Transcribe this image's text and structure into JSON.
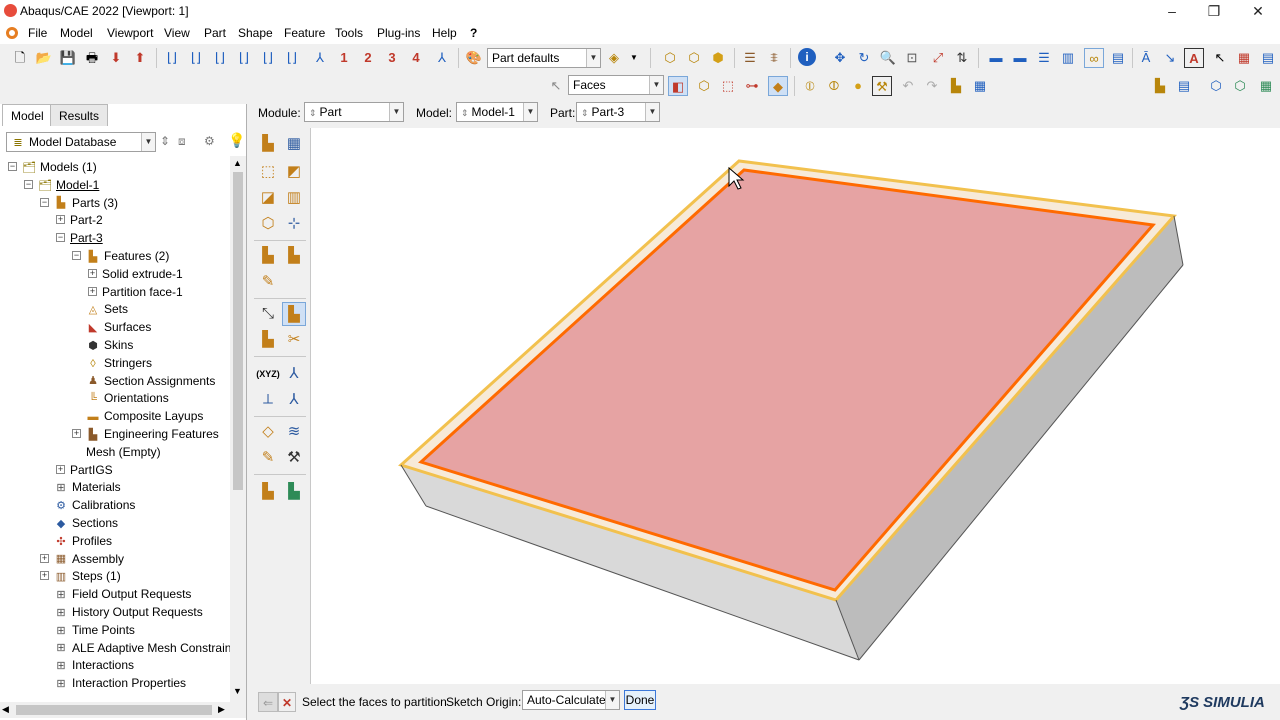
{
  "window": {
    "title": "Abaqus/CAE 2022 [Viewport: 1]",
    "controls": [
      "–",
      "❐",
      "✕"
    ],
    "resize_controls": [
      "–",
      "❐",
      "✕"
    ]
  },
  "menu": [
    {
      "label": "File"
    },
    {
      "label": "Model"
    },
    {
      "label": "Viewport"
    },
    {
      "label": "View"
    },
    {
      "label": "Part"
    },
    {
      "label": "Shape"
    },
    {
      "label": "Feature"
    },
    {
      "label": "Tools"
    },
    {
      "label": "Plug-ins"
    },
    {
      "label": "Help"
    },
    {
      "label": "?"
    }
  ],
  "toolbar": {
    "view_numbers": [
      "1",
      "2",
      "3",
      "4"
    ],
    "part_defaults": "Part defaults",
    "selection_filter": "Faces"
  },
  "context": {
    "module_label": "Module:",
    "module_value": "Part",
    "model_label": "Model:",
    "model_value": "Model-1",
    "part_label": "Part:",
    "part_value": "Part-3"
  },
  "left_panel": {
    "tabs": [
      "Model",
      "Results"
    ],
    "database_combo": "Model Database",
    "tree": [
      {
        "label": "Models (1)",
        "level": 0,
        "exp": "-"
      },
      {
        "label": "Model-1",
        "level": 1,
        "exp": "-",
        "underline": true
      },
      {
        "label": "Parts (3)",
        "level": 2,
        "exp": "-"
      },
      {
        "label": "Part-2",
        "level": 3,
        "exp": "+"
      },
      {
        "label": "Part-3",
        "level": 3,
        "exp": "-",
        "underline": true
      },
      {
        "label": "Features (2)",
        "level": 4,
        "exp": "-"
      },
      {
        "label": "Solid extrude-1",
        "level": 5,
        "exp": "+"
      },
      {
        "label": "Partition face-1",
        "level": 5,
        "exp": "+"
      },
      {
        "label": "Sets",
        "level": 4,
        "exp": ""
      },
      {
        "label": "Surfaces",
        "level": 4,
        "exp": ""
      },
      {
        "label": "Skins",
        "level": 4,
        "exp": ""
      },
      {
        "label": "Stringers",
        "level": 4,
        "exp": ""
      },
      {
        "label": "Section Assignments",
        "level": 4,
        "exp": ""
      },
      {
        "label": "Orientations",
        "level": 4,
        "exp": ""
      },
      {
        "label": "Composite Layups",
        "level": 4,
        "exp": ""
      },
      {
        "label": "Engineering Features",
        "level": 4,
        "exp": "+"
      },
      {
        "label": "Mesh (Empty)",
        "level": 4,
        "exp": ""
      },
      {
        "label": "PartIGS",
        "level": 3,
        "exp": "+"
      },
      {
        "label": "Materials",
        "level": 2,
        "exp": ""
      },
      {
        "label": "Calibrations",
        "level": 2,
        "exp": ""
      },
      {
        "label": "Sections",
        "level": 2,
        "exp": ""
      },
      {
        "label": "Profiles",
        "level": 2,
        "exp": ""
      },
      {
        "label": "Assembly",
        "level": 2,
        "exp": "+"
      },
      {
        "label": "Steps (1)",
        "level": 2,
        "exp": "+"
      },
      {
        "label": "Field Output Requests",
        "level": 2,
        "exp": ""
      },
      {
        "label": "History Output Requests",
        "level": 2,
        "exp": ""
      },
      {
        "label": "Time Points",
        "level": 2,
        "exp": ""
      },
      {
        "label": "ALE Adaptive Mesh Constraints",
        "level": 2,
        "exp": ""
      },
      {
        "label": "Interactions",
        "level": 2,
        "exp": ""
      },
      {
        "label": "Interaction Properties",
        "level": 2,
        "exp": ""
      }
    ]
  },
  "prompt": {
    "text": "Select the faces to partition",
    "origin_label": "Sketch Origin:",
    "origin_value": "Auto-Calculate",
    "done": "Done"
  },
  "brand": "SIMULIA",
  "colors": {
    "face_fill": "#e6a3a3",
    "face_highlight": "#ff6a00",
    "edge_yellow": "#f2c14e",
    "border_band": "#f7ead8",
    "side_light": "#d9d9d9",
    "side_dark": "#bdbdbd"
  }
}
